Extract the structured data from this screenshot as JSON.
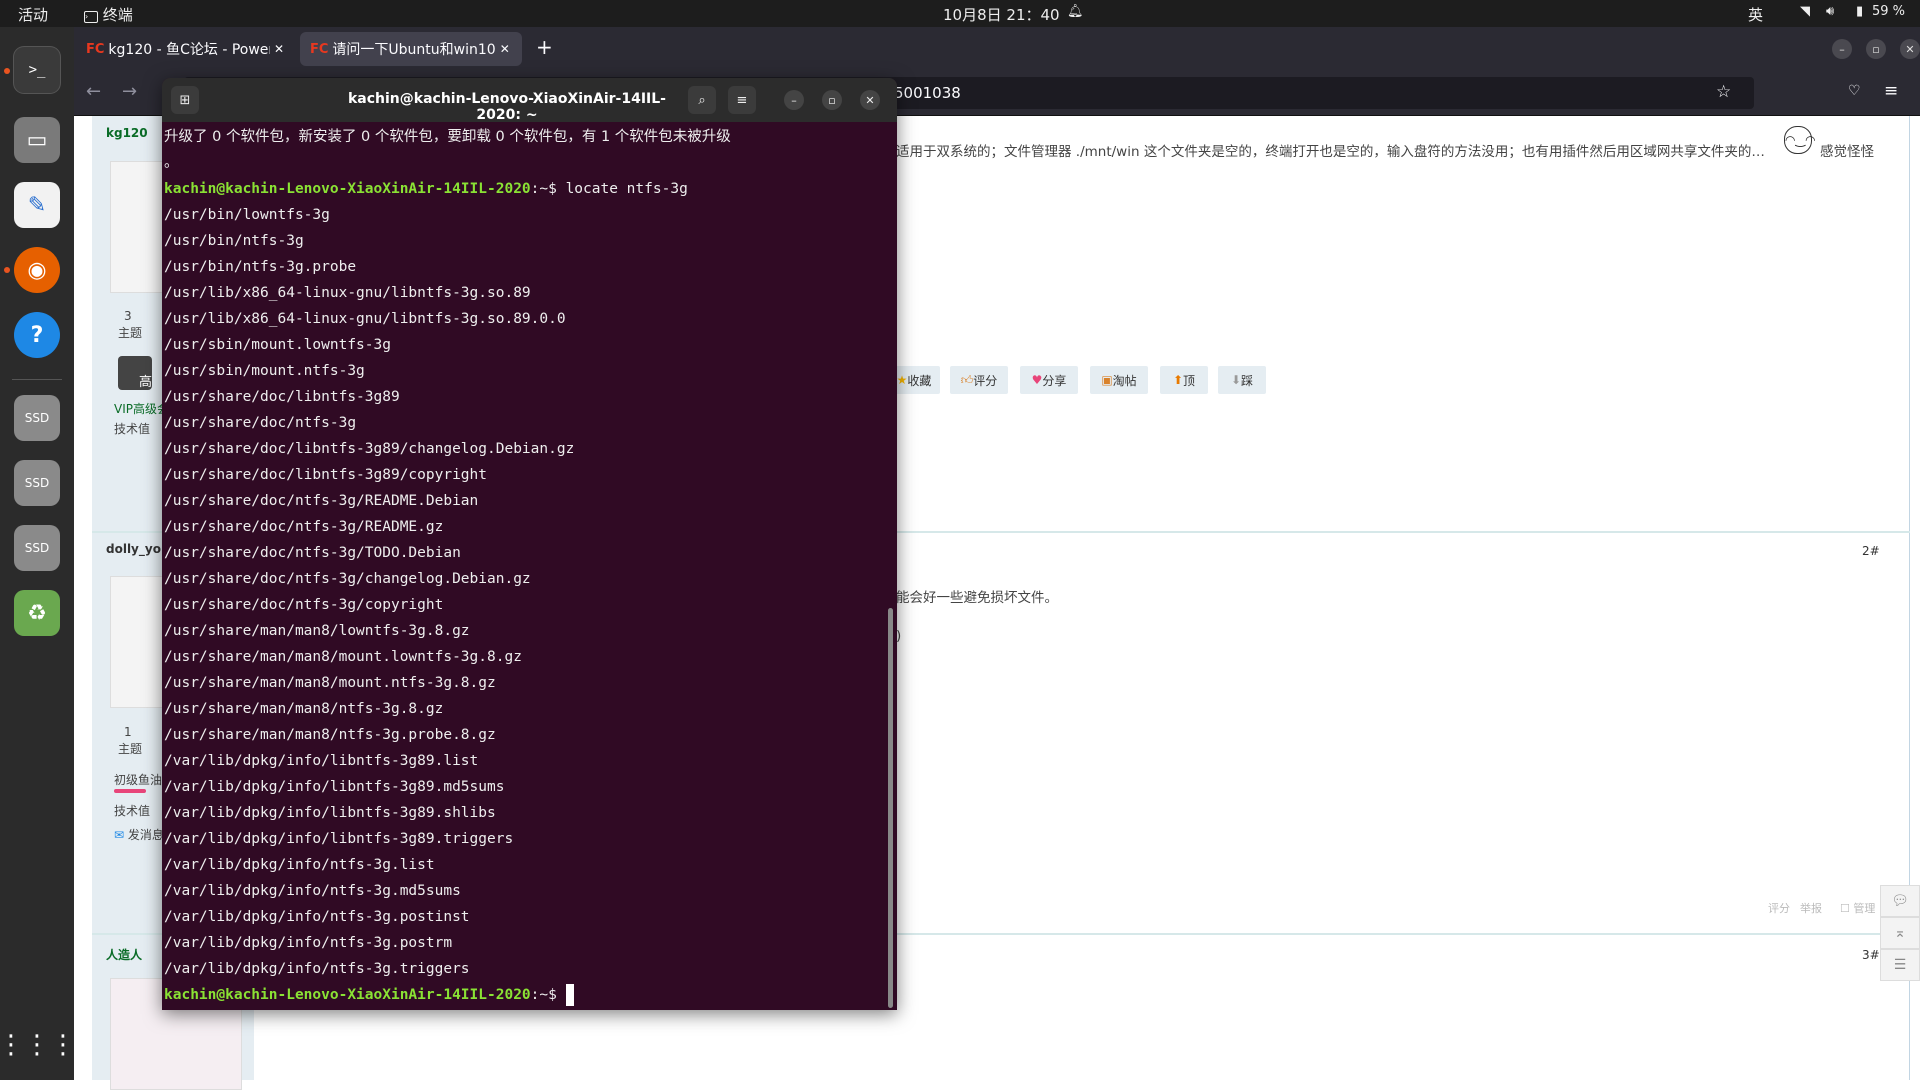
{
  "topbar": {
    "activities": "活动",
    "app": "终端",
    "clock": "10月8日 21：40",
    "input_method": "英",
    "battery": "59 %"
  },
  "dock": {
    "items": [
      "terminal",
      "files",
      "text-editor",
      "firefox",
      "help",
      "ssd-1",
      "ssd-2",
      "ssd-3",
      "trash",
      "app-grid"
    ]
  },
  "browser": {
    "tabs": [
      {
        "label": "kg120 - 鱼C论坛 - Powere",
        "favicon": "FC"
      },
      {
        "label": "请问一下Ubuntu和win10",
        "favicon": "FC"
      }
    ],
    "url_fragment": "5001038",
    "post_text": "适用于双系统的；文件管理器 ./mnt/win 这个文件夹是空的，终端打开也是空的，输入盘符的方法没用；也有用插件然后用区域网共享文件夹的…",
    "post_text_end": "感觉怪怪",
    "actions": [
      "收藏",
      "评分",
      "分享",
      "淘帖",
      "顶",
      "踩"
    ],
    "reply_text": "能会好一些避免损坏文件。",
    "reply_paren": ")",
    "footer_links": [
      "评分",
      "举报",
      "管理"
    ],
    "users": [
      {
        "name": "kg120",
        "topics_count": "3",
        "topics_label": "主题",
        "group": "VIP高级会",
        "badge": "高",
        "tech": "技术值"
      },
      {
        "name": "dolly_yo",
        "topics_count": "1",
        "topics_label": "主题",
        "group": "初级鱼油",
        "tech": "技术值",
        "msg": "发消息"
      },
      {
        "name": "人造人"
      }
    ],
    "floors": [
      "2#",
      "3#"
    ]
  },
  "terminal": {
    "title": "kachin@kachin-Lenovo-XiaoXinAir-14IIL-2020: ~",
    "first_line": "升级了 0 个软件包，新安装了 0 个软件包，要卸载 0 个软件包，有 1 个软件包未被升级",
    "first_line_wrap": "。",
    "prompt": "kachin@kachin-Lenovo-XiaoXinAir-14IIL-2020",
    "prompt_suffix": ":~$ ",
    "command": "locate ntfs-3g",
    "output": [
      "/usr/bin/lowntfs-3g",
      "/usr/bin/ntfs-3g",
      "/usr/bin/ntfs-3g.probe",
      "/usr/lib/x86_64-linux-gnu/libntfs-3g.so.89",
      "/usr/lib/x86_64-linux-gnu/libntfs-3g.so.89.0.0",
      "/usr/sbin/mount.lowntfs-3g",
      "/usr/sbin/mount.ntfs-3g",
      "/usr/share/doc/libntfs-3g89",
      "/usr/share/doc/ntfs-3g",
      "/usr/share/doc/libntfs-3g89/changelog.Debian.gz",
      "/usr/share/doc/libntfs-3g89/copyright",
      "/usr/share/doc/ntfs-3g/README.Debian",
      "/usr/share/doc/ntfs-3g/README.gz",
      "/usr/share/doc/ntfs-3g/TODO.Debian",
      "/usr/share/doc/ntfs-3g/changelog.Debian.gz",
      "/usr/share/doc/ntfs-3g/copyright",
      "/usr/share/man/man8/lowntfs-3g.8.gz",
      "/usr/share/man/man8/mount.lowntfs-3g.8.gz",
      "/usr/share/man/man8/mount.ntfs-3g.8.gz",
      "/usr/share/man/man8/ntfs-3g.8.gz",
      "/usr/share/man/man8/ntfs-3g.probe.8.gz",
      "/var/lib/dpkg/info/libntfs-3g89.list",
      "/var/lib/dpkg/info/libntfs-3g89.md5sums",
      "/var/lib/dpkg/info/libntfs-3g89.shlibs",
      "/var/lib/dpkg/info/libntfs-3g89.triggers",
      "/var/lib/dpkg/info/ntfs-3g.list",
      "/var/lib/dpkg/info/ntfs-3g.md5sums",
      "/var/lib/dpkg/info/ntfs-3g.postinst",
      "/var/lib/dpkg/info/ntfs-3g.postrm",
      "/var/lib/dpkg/info/ntfs-3g.triggers"
    ]
  },
  "colors": {
    "terminal_bg": "#300a24",
    "prompt": "#8ae234",
    "ubuntu_orange": "#e95420"
  }
}
